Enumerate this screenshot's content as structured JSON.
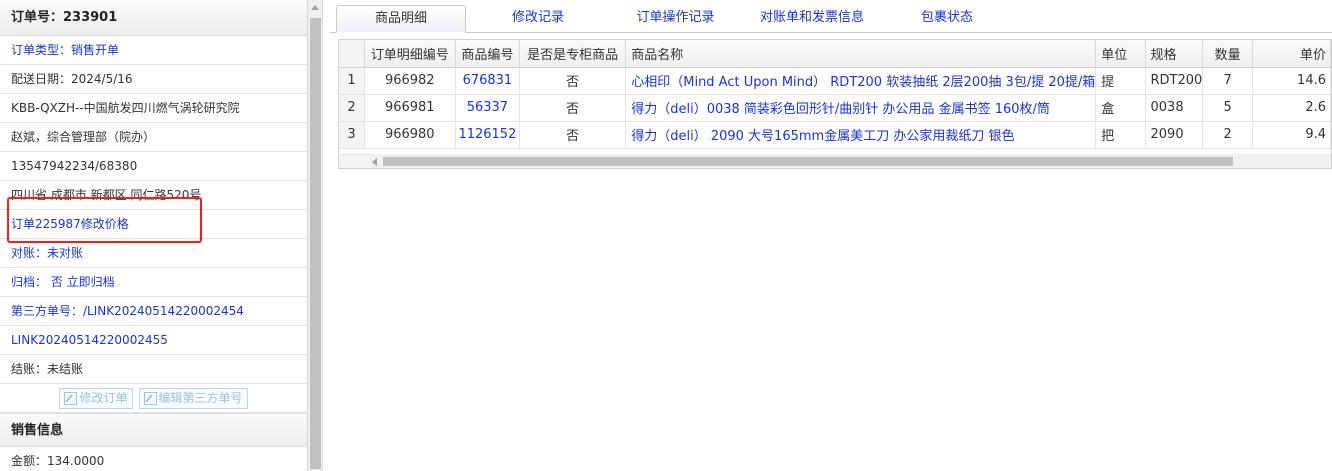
{
  "left_panel": {
    "title": "订单号：233901",
    "rows": [
      {
        "text": "订单类型：销售开单",
        "color": "blue"
      },
      {
        "text": "配送日期：2024/5/16",
        "color": "normal"
      },
      {
        "text": "KBB-QXZH--中国航发四川燃气涡轮研究院",
        "color": "normal"
      },
      {
        "text": "赵斌，综合管理部（院办）",
        "color": "normal"
      },
      {
        "text": "13547942234/68380",
        "color": "normal"
      },
      {
        "text": "四川省 成都市 新都区 同仁路520号",
        "color": "normal"
      },
      {
        "text": "订单225987修改价格",
        "color": "blue"
      },
      {
        "text": "对账：未对账",
        "color": "blue"
      },
      {
        "text": "归档：  否 立即归档",
        "color": "blue"
      },
      {
        "text": "第三方单号：/LINK20240514220002454",
        "color": "blue"
      },
      {
        "text": "LINK20240514220002455",
        "color": "blue"
      },
      {
        "text": "结账：未结账",
        "color": "normal"
      }
    ],
    "buttons": {
      "edit_order": "修改订单",
      "edit_third_party": "编辑第三方单号"
    },
    "sales_section_title": "销售信息",
    "amount_text": "金额：134.0000"
  },
  "tabs": [
    {
      "label": "商品明细",
      "active": true
    },
    {
      "label": "修改记录",
      "active": false
    },
    {
      "label": "订单操作记录",
      "active": false
    },
    {
      "label": "对账单和发票信息",
      "active": false
    },
    {
      "label": "包裹状态",
      "active": false
    }
  ],
  "grid": {
    "columns": [
      "",
      "订单明细编号",
      "商品编号",
      "是否是专柜商品",
      "商品名称",
      "单位",
      "规格",
      "数量",
      "单价"
    ],
    "rows": [
      {
        "idx": "1",
        "detail_id": "966982",
        "product_id": "676831",
        "is_counter": "否",
        "name": "心相印（Mind Act Upon Mind） RDT200 软装抽纸 2层200抽 3包/提 20提/箱",
        "unit": "提",
        "spec": "RDT200",
        "qty": "7",
        "price": "14.6"
      },
      {
        "idx": "2",
        "detail_id": "966981",
        "product_id": "56337",
        "is_counter": "否",
        "name": "得力（deli）0038 简装彩色回形针/曲别针 办公用品 金属书签 160枚/筒",
        "unit": "盒",
        "spec": "0038",
        "qty": "5",
        "price": "2.6"
      },
      {
        "idx": "3",
        "detail_id": "966980",
        "product_id": "1126152",
        "is_counter": "否",
        "name": "得力（deli） 2090 大号165mm金属美工刀 办公家用裁纸刀 银色",
        "unit": "把",
        "spec": "2090",
        "qty": "2",
        "price": "9.4"
      }
    ]
  }
}
